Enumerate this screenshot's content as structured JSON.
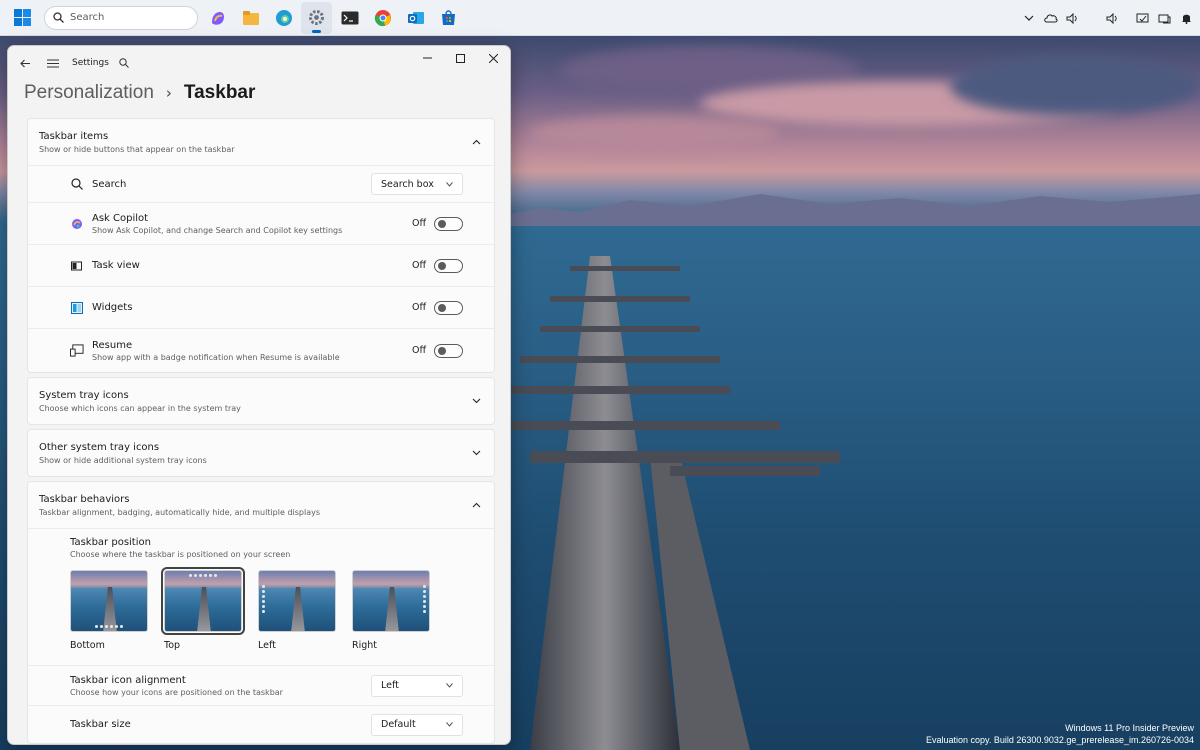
{
  "taskbar": {
    "search_placeholder": "Search",
    "apps": [
      {
        "name": "copilot-icon",
        "color": "#7b5cff"
      },
      {
        "name": "file-explorer-icon",
        "color": "#f4b63f"
      },
      {
        "name": "edge-icon",
        "color": "#1f9bd7"
      },
      {
        "name": "settings-icon",
        "color": "#6c757d"
      },
      {
        "name": "terminal-icon",
        "color": "#2b2b2b"
      },
      {
        "name": "chrome-icon",
        "color": "#e94235"
      },
      {
        "name": "outlook-icon",
        "color": "#0f6cbd"
      },
      {
        "name": "store-icon",
        "color": "#1769c8"
      }
    ]
  },
  "window": {
    "title": "Settings",
    "breadcrumb_parent": "Personalization",
    "breadcrumb_separator": "›",
    "breadcrumb_current": "Taskbar"
  },
  "taskbar_items": {
    "title": "Taskbar items",
    "desc": "Show or hide buttons that appear on the taskbar",
    "search": {
      "label": "Search",
      "value": "Search box"
    },
    "copilot": {
      "label": "Ask Copilot",
      "desc": "Show Ask Copilot, and change Search and Copilot key settings",
      "state": "Off"
    },
    "taskview": {
      "label": "Task view",
      "state": "Off"
    },
    "widgets": {
      "label": "Widgets",
      "state": "Off"
    },
    "resume": {
      "label": "Resume",
      "desc": "Show app with a badge notification when Resume is available",
      "state": "Off"
    }
  },
  "system_tray": {
    "title": "System tray icons",
    "desc": "Choose which icons can appear in the system tray"
  },
  "other_tray": {
    "title": "Other system tray icons",
    "desc": "Show or hide additional system tray icons"
  },
  "behaviors": {
    "title": "Taskbar behaviors",
    "desc": "Taskbar alignment, badging, automatically hide, and multiple displays",
    "position": {
      "title": "Taskbar position",
      "desc": "Choose where the taskbar is positioned on your screen",
      "options": [
        "Bottom",
        "Top",
        "Left",
        "Right"
      ],
      "selected": "Top"
    },
    "alignment": {
      "title": "Taskbar icon alignment",
      "desc": "Choose how your icons are positioned on the taskbar",
      "value": "Left"
    },
    "size": {
      "title": "Taskbar size",
      "value": "Default"
    }
  },
  "watermark": {
    "line1": "Windows 11 Pro Insider Preview",
    "line2": "Evaluation copy. Build 26300.9032.ge_prerelease_im.260726-0034"
  }
}
